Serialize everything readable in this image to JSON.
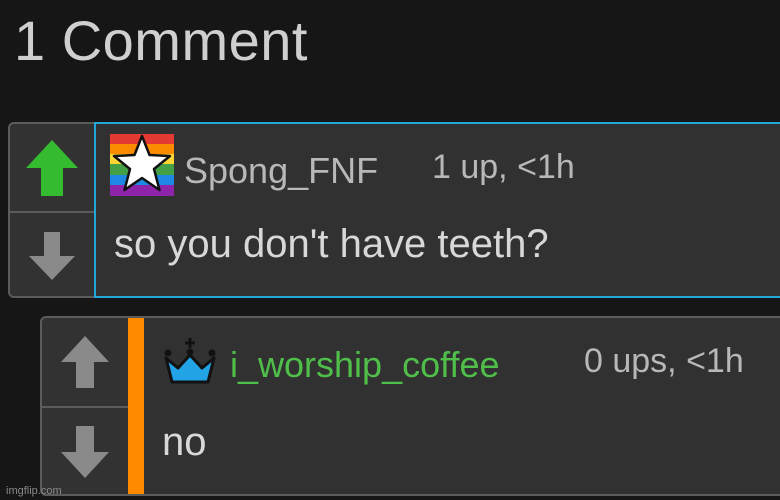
{
  "header": {
    "title": "1 Comment"
  },
  "comments": [
    {
      "username": "Spong_FNF",
      "username_color": "#b8b8b8",
      "meta": "1 up, <1h",
      "text": "so you don't have teeth?",
      "avatar": "rainbow-star-flair",
      "upvoted": true,
      "accent_color": "#21a7d8"
    },
    {
      "username": "i_worship_coffee",
      "username_color": "#4fbf4a",
      "meta": "0 ups, <1h",
      "text": "no",
      "avatar": "blue-crown-icon",
      "upvoted": false,
      "accent_color": "#ff8a00"
    }
  ],
  "watermark": "imgflip.com"
}
